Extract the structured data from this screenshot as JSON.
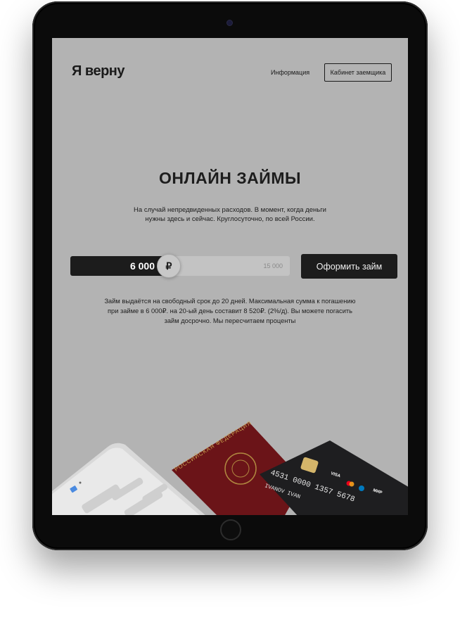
{
  "header": {
    "logo": "Я верну",
    "nav_info": "Информация",
    "cabinet_button": "Кабинет заемщика"
  },
  "hero": {
    "title": "ОНЛАЙН ЗАЙМЫ",
    "subtitle": "На случай непредвиденных расходов. В момент, когда деньги нужны здесь и сейчас. Круглосуточно, по всей России."
  },
  "loan_slider": {
    "value": "6 000",
    "value_number": 6000,
    "max_label": "15 000",
    "max_number": 15000,
    "currency_symbol": "₽"
  },
  "apply_button": "Оформить займ",
  "info_text": "Займ выдаётся на свободный срок до 20 дней. Максимальная сумма к погашению при займе в 6 000₽. на 20-ый день составит 8 520₽. (2%/д). Вы можете погасить займ досрочно. Мы пересчитаем проценты",
  "illustration": {
    "card_number": "4531 0000 1357 5678",
    "card_holder": "IVANOV IVAN",
    "card_brand_1": "VISA",
    "card_brand_2": "МИР",
    "passport_text": "РОССИЙСКАЯ ФЕДЕРАЦИЯ"
  },
  "colors": {
    "screen_bg": "#b3b3b3",
    "dark": "#1c1c1c",
    "passport": "#6b1418",
    "card": "#1e1e20"
  }
}
